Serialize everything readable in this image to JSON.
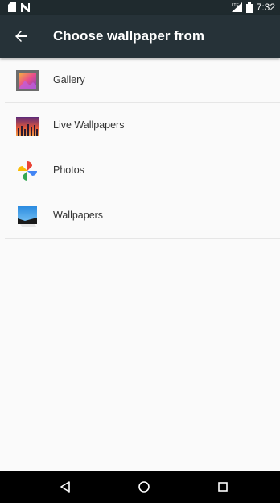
{
  "status_bar": {
    "time": "7:32",
    "icons": [
      "sd-card-icon",
      "notification-n-icon",
      "signal-icon",
      "battery-icon"
    ]
  },
  "app_bar": {
    "title": "Choose wallpaper from",
    "back_icon": "arrow-back-icon"
  },
  "list": {
    "items": [
      {
        "label": "Gallery",
        "icon": "gallery-icon"
      },
      {
        "label": "Live Wallpapers",
        "icon": "live-wallpapers-icon"
      },
      {
        "label": "Photos",
        "icon": "photos-icon"
      },
      {
        "label": "Wallpapers",
        "icon": "wallpapers-icon"
      }
    ]
  },
  "nav_bar": {
    "icons": [
      "back-triangle-icon",
      "home-circle-icon",
      "recents-square-icon"
    ]
  },
  "colors": {
    "status_bar": "#1f2a2e",
    "app_bar": "#263238",
    "background": "#fafafa",
    "nav_bar": "#000000"
  }
}
